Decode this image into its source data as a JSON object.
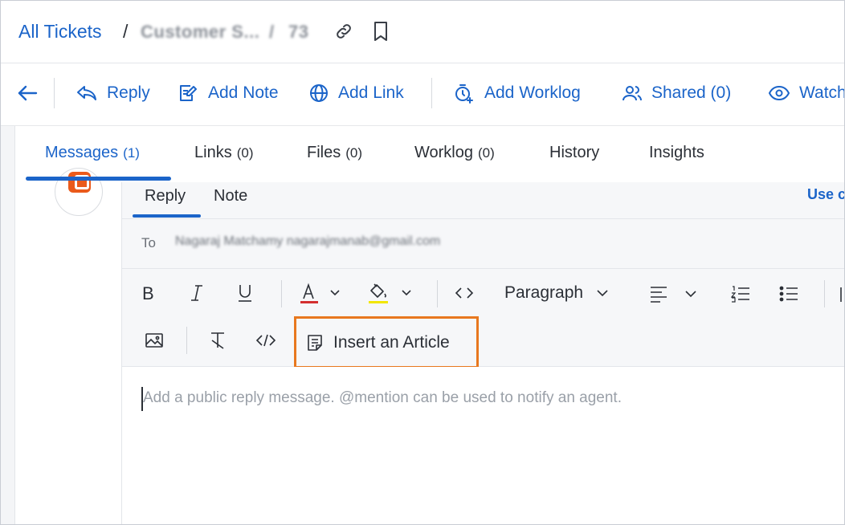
{
  "breadcrumb": {
    "root": "All Tickets",
    "separator": "/",
    "ticket_name": "Customer S...",
    "ticket_separator": "/",
    "ticket_id": "73"
  },
  "header_icons": [
    "link-icon",
    "bookmark-icon"
  ],
  "toolbar": {
    "back_icon": "arrow-left-icon",
    "reply": "Reply",
    "add_note": "Add Note",
    "add_link": "Add Link",
    "add_worklog": "Add Worklog",
    "shared": "Shared (0)",
    "watch": "Watch"
  },
  "tabs": [
    {
      "label": "Messages",
      "count": "(1)",
      "active": true
    },
    {
      "label": "Links",
      "count": "(0)"
    },
    {
      "label": "Files",
      "count": "(0)"
    },
    {
      "label": "Worklog",
      "count": "(0)"
    },
    {
      "label": "History",
      "count": ""
    },
    {
      "label": "Insights",
      "count": ""
    }
  ],
  "composer": {
    "tabs": [
      "Reply",
      "Note"
    ],
    "active_tab": "Reply",
    "use_link": "Use c",
    "to_label": "To",
    "to_value": "Nagaraj Matchamy nagarajmanab@gmail.com",
    "format": {
      "paragraph": "Paragraph",
      "insert_article": "Insert an Article",
      "font_color": "#d32f2f",
      "highlight_color": "#f2e600"
    },
    "placeholder": "Add a public reply message. @mention can be used to notify an agent."
  },
  "colors": {
    "accent": "#1b64c9",
    "highlight_border": "#e8781f",
    "avatar_brand": "#ea5a1b"
  }
}
